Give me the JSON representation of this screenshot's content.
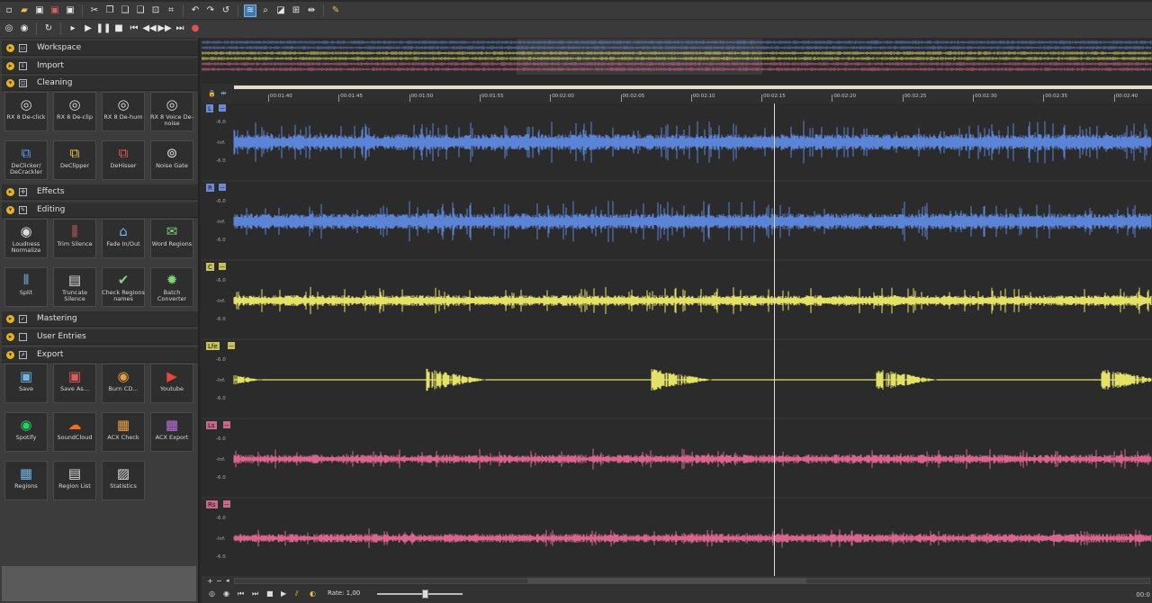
{
  "toolbar_main": {
    "icons": [
      "new-file-icon",
      "open-folder-icon",
      "save-icon",
      "save-as-icon",
      "save-all-icon",
      "cut-icon",
      "copy-icon",
      "paste-icon",
      "paste-mix-icon",
      "trim-icon",
      "crop-icon",
      "undo-icon",
      "redo-icon",
      "redo-all-icon",
      "waveform-view-icon",
      "zoom-icon",
      "spectral-icon",
      "selection-icon",
      "snap-icon",
      "plugin-icon"
    ]
  },
  "toolbar_transport": {
    "icons": [
      "record-mode-icon",
      "loop-mode-icon",
      "loop-icon",
      "play-icon",
      "play-all-icon",
      "pause-icon",
      "stop-icon",
      "go-start-icon",
      "rewind-icon",
      "fast-forward-icon",
      "go-end-icon",
      "record-icon"
    ]
  },
  "panel": {
    "sections": [
      {
        "id": "workspace",
        "title": "Workspace"
      },
      {
        "id": "import",
        "title": "Import"
      },
      {
        "id": "cleaning",
        "title": "Cleaning"
      },
      {
        "id": "effects",
        "title": "Effects"
      },
      {
        "id": "editing",
        "title": "Editing"
      },
      {
        "id": "mastering",
        "title": "Mastering"
      },
      {
        "id": "user-entries",
        "title": "User Entries"
      },
      {
        "id": "export",
        "title": "Export"
      }
    ],
    "cleaning_tiles": [
      {
        "label": "RX 8 De-click"
      },
      {
        "label": "RX 8 De-clip"
      },
      {
        "label": "RX 8 De-hum"
      },
      {
        "label": "RX 8 Voice De-noise"
      },
      {
        "label": "DeClicker/ DeCrackler"
      },
      {
        "label": "DeClipper"
      },
      {
        "label": "DeHisser"
      },
      {
        "label": "Noise Gate"
      }
    ],
    "editing_tiles": [
      {
        "label": "Loudness Normalize"
      },
      {
        "label": "Trim Silence"
      },
      {
        "label": "Fade In/Out"
      },
      {
        "label": "Word Regions"
      },
      {
        "label": "Split"
      },
      {
        "label": "Truncate Silence"
      },
      {
        "label": "Check Regions names"
      },
      {
        "label": "Batch Converter"
      }
    ],
    "export_tiles": [
      {
        "label": "Save"
      },
      {
        "label": "Save As..."
      },
      {
        "label": "Burn CD..."
      },
      {
        "label": "Youtube"
      },
      {
        "label": "Spotify"
      },
      {
        "label": "SoundCloud"
      },
      {
        "label": "ACX Check"
      },
      {
        "label": "ACX Export"
      },
      {
        "label": "Regions"
      },
      {
        "label": "Region List"
      },
      {
        "label": "Statistics"
      }
    ]
  },
  "ruler": {
    "ticks": [
      "00:01:40",
      "00:01:45",
      "00:01:50",
      "00:01:55",
      "00:02:00",
      "00:02:05",
      "00:02:10",
      "00:02:15",
      "00:02:20",
      "00:02:25",
      "00:02:30",
      "00:02:35",
      "00:02:40"
    ]
  },
  "tracks": [
    {
      "channel": "L",
      "color": "#5b84d6",
      "label_bg": "#6c8bd4"
    },
    {
      "channel": "R",
      "color": "#5b84d6",
      "label_bg": "#6c8bd4"
    },
    {
      "channel": "C",
      "color": "#e4e266",
      "label_bg": "#c7c25a"
    },
    {
      "channel": "Lfe",
      "color": "#e4e266",
      "label_bg": "#c7c25a"
    },
    {
      "channel": "Ls",
      "color": "#d9648e",
      "label_bg": "#c56a8d"
    },
    {
      "channel": "Rs",
      "color": "#d9648e",
      "label_bg": "#c56a8d"
    }
  ],
  "db_labels": {
    "top": "-6.0",
    "mid": "-Inf.",
    "bottom": "-6.0"
  },
  "bottom": {
    "rate_label": "Rate: 1,00",
    "timecode": "00:0"
  },
  "colors": {
    "accent": "#e7b21d",
    "blue_wave": "#5b84d6",
    "yellow_wave": "#e4e266",
    "pink_wave": "#d9648e"
  }
}
